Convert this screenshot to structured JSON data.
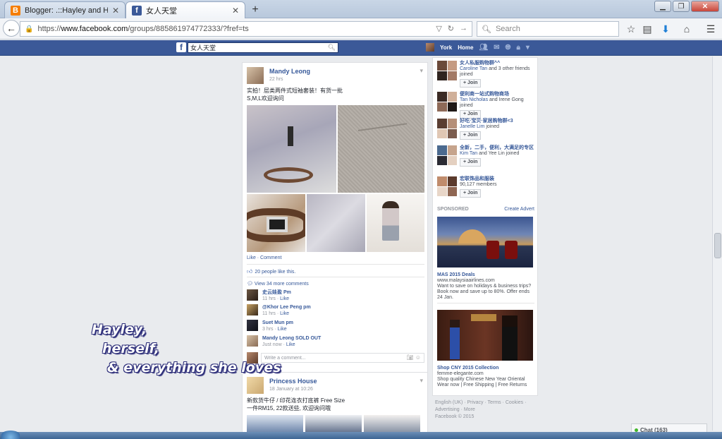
{
  "browser": {
    "tabs": [
      {
        "title": "Blogger: .::Hayley and Hers...",
        "favicon": "B",
        "color": "#f57d00"
      },
      {
        "title": "女人天堂",
        "favicon": "f",
        "color": "#3b5998"
      }
    ],
    "new_tab": "+",
    "url_prefix": "https://",
    "url_domain": "www.facebook.com",
    "url_path": "/groups/885861974772333/?fref=ts",
    "search_placeholder": "Search"
  },
  "facebook": {
    "search_value": "女人天堂",
    "user_name": "York",
    "home_label": "Home"
  },
  "post1": {
    "author": "Mandy Leong",
    "time": "22 hrs",
    "text_line1": "实拍！层类两件式短袖套装！有货一批",
    "text_line2": "S,M,L欢迎询问",
    "actions": "Like · Comment",
    "likes": "20 people like this.",
    "view_more": "View 34 more comments",
    "comments": [
      {
        "name": "史云娃盈 Pm",
        "meta": "11 hrs · ",
        "like": "Like"
      },
      {
        "name": "@Khor Lee Peng pm",
        "meta": "11 hrs · ",
        "like": "Like"
      },
      {
        "name": "Suet Mun pm",
        "meta": "3 hrs · ",
        "like": "Like"
      },
      {
        "name": "Mandy Leong SOLD OUT",
        "meta": "Just now · ",
        "like": "Like"
      }
    ],
    "write_comment": "Write a comment..."
  },
  "post2": {
    "author": "Princess House",
    "time": "18 January at 10:26",
    "text_line1": "新款货牛仔 / 印花连衣打底裤 Free Size",
    "text_line2": "一件RM15, 22款送些, 欢迎询问哦"
  },
  "groups": [
    {
      "name": "女人私服购物群^^",
      "joined_name": "Caroline Tan",
      "joined_rest": " and 3 other friends joined",
      "join": "+ Join"
    },
    {
      "name": "便利商一站式购物商场",
      "joined_name": "Tan Nicholas",
      "joined_rest": " and Irene Gong joined",
      "join": "+ Join"
    },
    {
      "name": "好吃·宝贝·家居购物群<3",
      "joined_name": "Janelle Lim",
      "joined_rest": " joined",
      "join": "+ Join"
    },
    {
      "name": "全新，二手，便利，大满足的专区",
      "joined_name": "Kim Tan",
      "joined_rest": " and Yee Lin joined",
      "join": "+ Join"
    },
    {
      "name": "宏联饰品和服装",
      "joined_name": "",
      "joined_rest": "90,127 members",
      "join": "+ Join"
    }
  ],
  "sponsored": {
    "label": "SPONSORED",
    "create": "Create Advert"
  },
  "ads": [
    {
      "title": "MAS 2015 Deals",
      "url": "www.malaysiaairlines.com",
      "desc": "Want to save on holidays & business trips? Book now and save up to 80%. Offer ends 24 Jan."
    },
    {
      "title": "Shop CNY 2015 Collection",
      "url": "femme-elegante.com",
      "desc": "Shop quality Chinese New Year Oriental Wear now | Free Shipping | Free Returns"
    }
  ],
  "footer": {
    "line1": "English (UK) · Privacy · Terms · Cookies ·",
    "line2": "Advertising · More",
    "line3": "Facebook © 2015"
  },
  "chat": "Chat (163)",
  "watermark": {
    "line1": "Hayley,",
    "line2": "herself,",
    "line3": "& everything she loves"
  }
}
